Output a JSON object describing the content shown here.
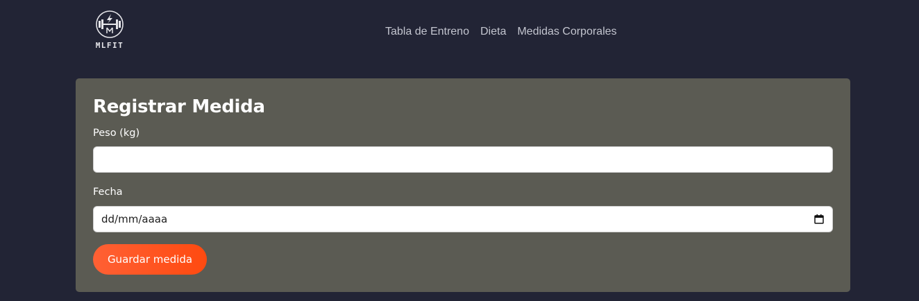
{
  "brand": {
    "logo_text": "MLFIT",
    "logo_icon": "dumbbell-lightning-icon"
  },
  "nav": {
    "items": [
      {
        "label": "Tabla de Entreno"
      },
      {
        "label": "Dieta"
      },
      {
        "label": "Medidas Corporales"
      }
    ]
  },
  "form": {
    "title": "Registrar Medida",
    "weight_label": "Peso (kg)",
    "weight_value": "",
    "date_label": "Fecha",
    "date_placeholder": "dd/mm/aaaa",
    "date_icon": "calendar-icon",
    "submit_label": "Guardar medida"
  },
  "colors": {
    "page_background": "#222435",
    "card_background": "#5b5b53",
    "accent": "#ff5020",
    "nav_text": "#c3c5cf"
  }
}
